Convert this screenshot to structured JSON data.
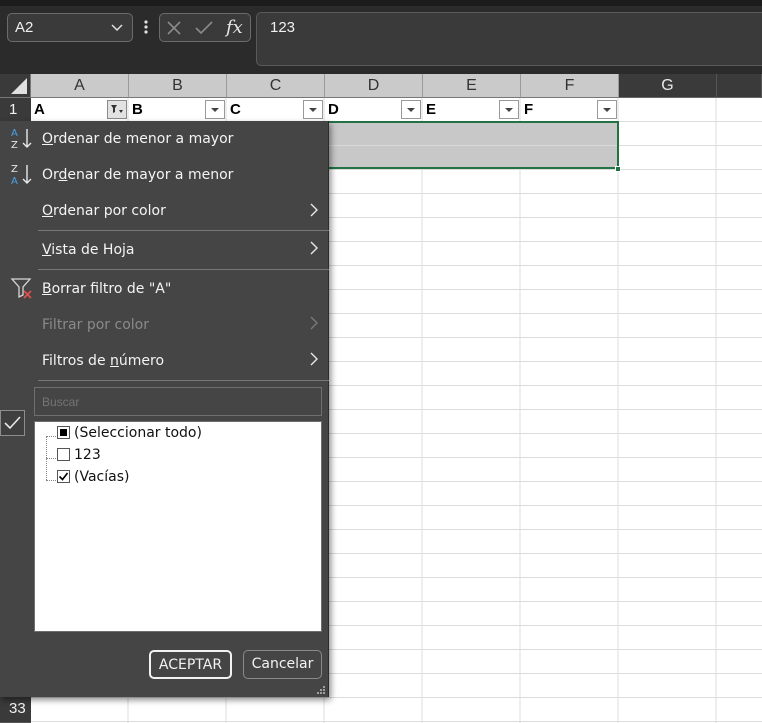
{
  "name_box": {
    "value": "A2"
  },
  "formula_bar": {
    "value": "123",
    "fx_label": "fx"
  },
  "column_headers": [
    "A",
    "B",
    "C",
    "D",
    "E",
    "F",
    "G"
  ],
  "row_headers": [
    "1",
    "33"
  ],
  "header_row": {
    "cells": [
      "A",
      "B",
      "C",
      "D",
      "E",
      "F"
    ]
  },
  "filter_menu": {
    "sort_asc": {
      "pre": "",
      "key": "O",
      "post": "rdenar de menor a mayor"
    },
    "sort_desc": {
      "pre": "Or",
      "key": "d",
      "post": "enar de mayor a menor"
    },
    "sort_by_color": {
      "pre": "",
      "key": "O",
      "post": "rdenar por color"
    },
    "sheet_view": {
      "pre": "",
      "key": "V",
      "post": "ista de Hoja"
    },
    "clear_filter": {
      "pre": "",
      "key": "B",
      "post": "orrar filtro de \"A\""
    },
    "filter_by_color": {
      "pre": "Filtrar por color",
      "key": "",
      "post": ""
    },
    "number_filters": {
      "pre": "Filtros de ",
      "key": "n",
      "post": "úmero"
    },
    "search_placeholder": "Buscar",
    "list": [
      {
        "label": "(Seleccionar todo)",
        "state": "partial"
      },
      {
        "label": "123",
        "state": "unchecked"
      },
      {
        "label": "(Vacías)",
        "state": "checked"
      }
    ],
    "ok_label": "ACEPTAR",
    "cancel_label": "Cancelar"
  },
  "colors": {
    "accent_green": "#217346",
    "panel_bg": "#454545",
    "selection_fill": "#c8c8c8",
    "az_blue": "#4aa3e8",
    "clear_red": "#e05050"
  }
}
